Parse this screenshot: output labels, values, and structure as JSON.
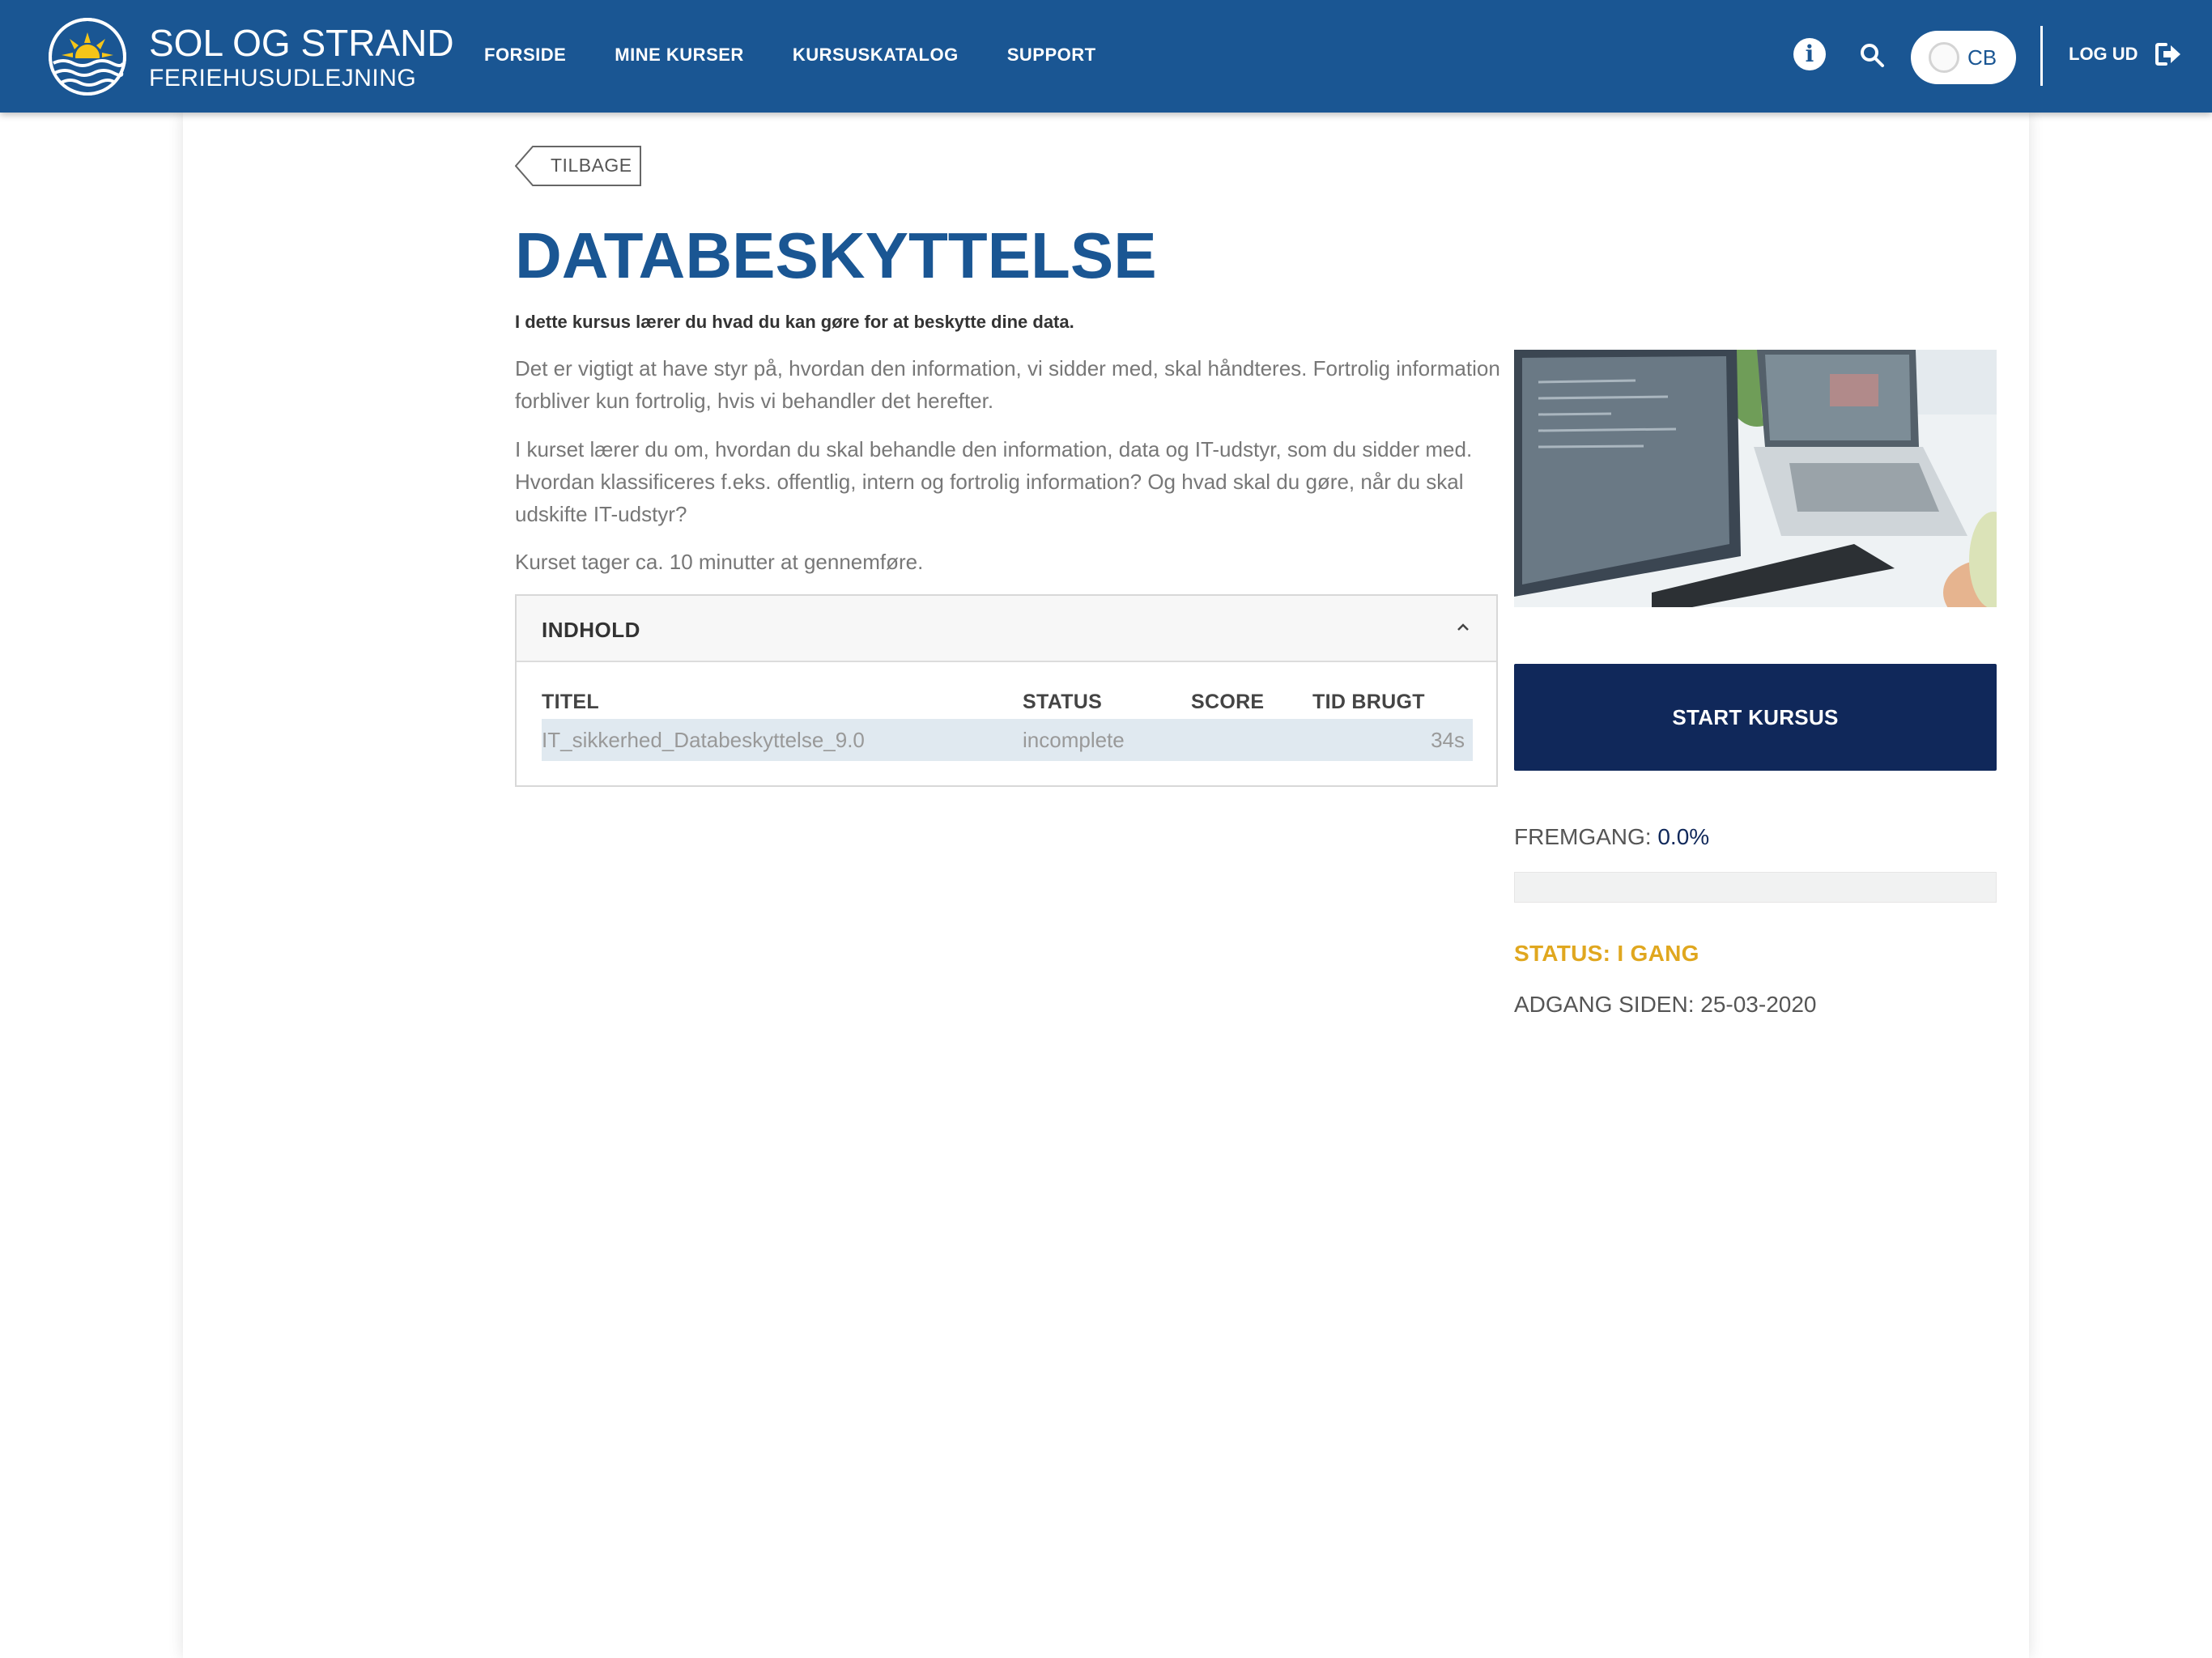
{
  "brand": {
    "title": "SOL OG STRAND",
    "subtitle": "FERIEHUSUDLEJNING",
    "colors": {
      "primary": "#1a5693",
      "dark_button": "#10285a",
      "status_in_progress": "#e0a71f",
      "logo_sun": "#f5c518"
    }
  },
  "nav": {
    "items": [
      "FORSIDE",
      "MINE KURSER",
      "KURSUSKATALOG",
      "SUPPORT"
    ]
  },
  "header": {
    "info_icon": "info-icon",
    "search_icon": "search-icon",
    "user_initials": "CB",
    "logout_label": "LOG UD",
    "logout_icon": "sign-out-icon"
  },
  "page": {
    "back_label": "TILBAGE",
    "title": "DATABESKYTTELSE",
    "lead": "I dette kursus lærer du hvad du kan gøre for at beskytte dine data.",
    "paragraphs": [
      "Det er vigtigt at have styr på, hvordan den information, vi sidder med, skal håndteres. Fortrolig information forbliver kun fortrolig, hvis vi behandler det herefter.",
      "I kurset lærer du om, hvordan du skal behandle den information, data og IT-udstyr, som du sidder med. Hvordan klassificeres f.eks. offentlig, intern og fortrolig information? Og hvad skal du gøre, når du skal udskifte IT-udstyr?",
      "Kurset tager ca. 10 minutter at gennemføre."
    ]
  },
  "content": {
    "heading": "INDHOLD",
    "columns": {
      "title": "TITEL",
      "status": "STATUS",
      "score": "SCORE",
      "time": "TID BRUGT"
    },
    "rows": [
      {
        "title": "IT_sikkerhed_Databeskyttelse_9.0",
        "status": "incomplete",
        "score": "",
        "time": "34s"
      }
    ]
  },
  "sidebar": {
    "start_button": "START KURSUS",
    "progress_label": "FREMGANG:",
    "progress_value": "0.0%",
    "progress_fraction": 0.0,
    "status": "STATUS: I GANG",
    "access": "ADGANG SIDEN: 25-03-2020"
  }
}
